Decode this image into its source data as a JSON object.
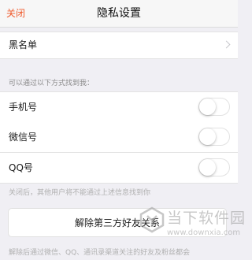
{
  "nav": {
    "close_label": "关闭",
    "title": "隐私设置"
  },
  "blacklist": {
    "label": "黑名单"
  },
  "find_section": {
    "header": "可以通过以下方式找到我：",
    "items": [
      {
        "label": "手机号",
        "enabled": false
      },
      {
        "label": "微信号",
        "enabled": false
      },
      {
        "label": "QQ号",
        "enabled": false
      }
    ],
    "footnote": "关闭后，其他用户将不能通过上述信息找到你"
  },
  "unbind": {
    "button_label": "解除第三方好友关系",
    "footnote": "解除后通过微信、QQ、通讯录渠道关注的好友及粉丝都会"
  },
  "watermark": {
    "title": "当下软件园",
    "url": "www.downxia.com"
  },
  "colors": {
    "accent": "#ef5a2c",
    "background": "#f0eff4"
  }
}
